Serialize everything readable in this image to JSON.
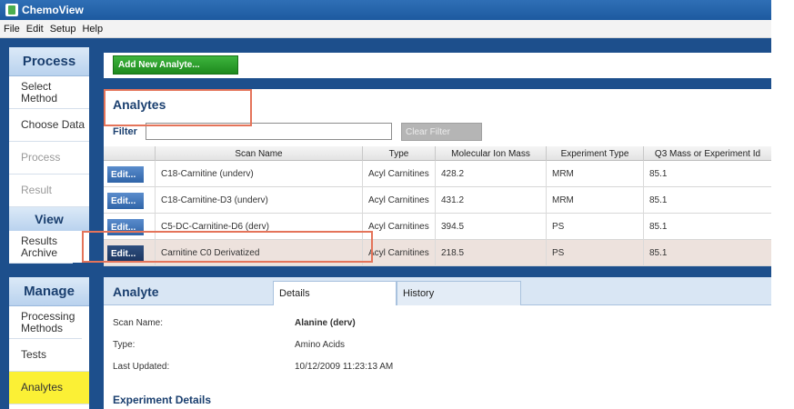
{
  "app": {
    "title": "ChemoView"
  },
  "menu": [
    "File",
    "Edit",
    "Setup",
    "Help"
  ],
  "nav": {
    "process_header": "Process",
    "process_items": [
      {
        "label": "Select Method",
        "state": "normal"
      },
      {
        "label": "Choose Data",
        "state": "normal"
      },
      {
        "label": "Process",
        "state": "disabled"
      },
      {
        "label": "Result",
        "state": "disabled"
      }
    ],
    "view_header": "View",
    "view_items": [
      {
        "label": "Results Archive"
      }
    ],
    "manage_header": "Manage",
    "manage_items": [
      {
        "label": "Processing Methods",
        "state": "normal"
      },
      {
        "label": "Tests",
        "state": "normal"
      },
      {
        "label": "Analytes",
        "state": "active"
      }
    ]
  },
  "toolbar": {
    "add_button": "Add New Analyte..."
  },
  "analytes": {
    "title": "Analytes",
    "filter_label": "Filter",
    "filter_value": "",
    "clear_button": "Clear Filter",
    "columns": [
      "Scan Name",
      "Type",
      "Molecular Ion Mass",
      "Experiment Type",
      "Q3 Mass or Experiment Id"
    ],
    "edit_label": "Edit...",
    "rows": [
      {
        "scan": "C18-Carnitine (underv)",
        "type": "Acyl Carnitines",
        "mass": "428.2",
        "exp": "MRM",
        "q3": "85.1"
      },
      {
        "scan": "C18-Carnitine-D3 (underv)",
        "type": "Acyl Carnitines",
        "mass": "431.2",
        "exp": "MRM",
        "q3": "85.1"
      },
      {
        "scan": "C5-DC-Carnitine-D6 (derv)",
        "type": "Acyl Carnitines",
        "mass": "394.5",
        "exp": "PS",
        "q3": "85.1"
      },
      {
        "scan": "Carnitine C0 Derivatized",
        "type": "Acyl Carnitines",
        "mass": "218.5",
        "exp": "PS",
        "q3": "85.1"
      }
    ],
    "selected_row": 3
  },
  "analyte": {
    "title": "Analyte",
    "tabs": [
      "Details",
      "History"
    ],
    "active_tab": "Details",
    "fields": [
      {
        "label": "Scan Name:",
        "value": "Alanine (derv)"
      },
      {
        "label": "Type:",
        "value": "Amino Acids"
      },
      {
        "label": "Last Updated:",
        "value": "10/12/2009 11:23:13 AM"
      }
    ],
    "section": "Experiment Details"
  },
  "colors": {
    "frame": "#1d4f8c",
    "accent_green": "#2a9d2a",
    "highlight": "#e4745a",
    "active_nav": "#fbf035"
  }
}
